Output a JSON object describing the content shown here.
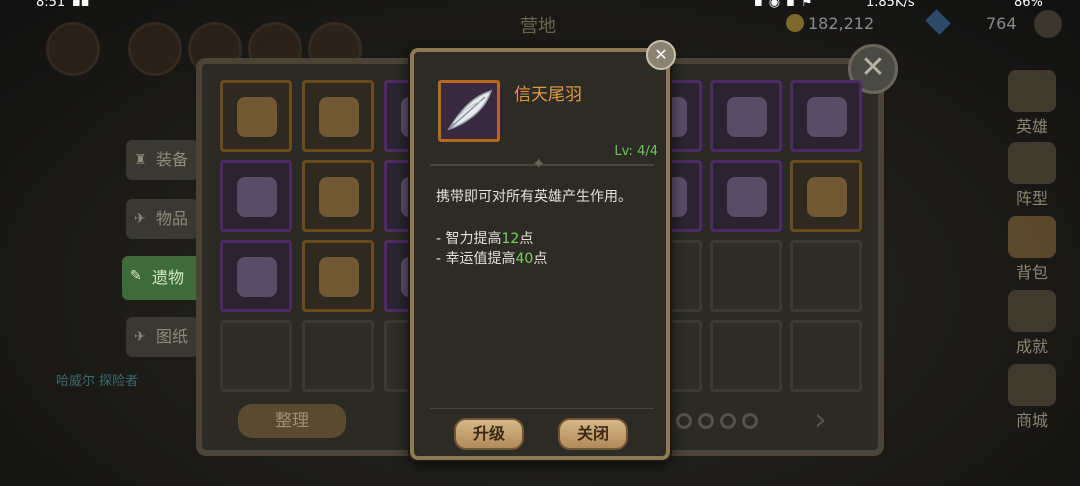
{
  "status_bar": {
    "time": "8:51",
    "left_icons": "▪▪",
    "signal_icons": "▪◉▪⚑",
    "net_speed": "1.85K/s",
    "battery": "86%"
  },
  "header": {
    "title": "营地",
    "gold": "182,212",
    "gems": "764"
  },
  "side_tabs": [
    {
      "label": "装备",
      "icon": "armor-icon"
    },
    {
      "label": "物品",
      "icon": "scroll-icon"
    },
    {
      "label": "遗物",
      "icon": "relic-icon"
    },
    {
      "label": "图纸",
      "icon": "blueprint-icon"
    }
  ],
  "sort_button": "整理",
  "footer_names": "哈威尔  探险者",
  "right_menu": [
    {
      "label": "英雄",
      "icon": "crown-icon"
    },
    {
      "label": "阵型",
      "icon": "target-icon"
    },
    {
      "label": "背包",
      "icon": "backpack-icon"
    },
    {
      "label": "成就",
      "icon": "trophy-icon"
    },
    {
      "label": "商城",
      "icon": "chest-icon"
    }
  ],
  "inventory_items": [
    {
      "name": "potion-bottle",
      "rarity": "orange"
    },
    {
      "name": "wheat-bundle",
      "rarity": "orange"
    },
    {
      "name": "bone-item",
      "rarity": "purple"
    },
    {
      "name": "crystal-shard",
      "rarity": "purple"
    },
    {
      "name": "dark-ore",
      "rarity": "purple"
    },
    {
      "name": "fang-item",
      "rarity": "purple"
    },
    {
      "name": "vial-item",
      "rarity": "purple"
    },
    {
      "name": "fern-leaf",
      "rarity": "orange"
    },
    {
      "name": "stone-item",
      "rarity": "purple"
    },
    {
      "name": "rock-item",
      "rarity": "purple"
    },
    {
      "name": "purple-moss",
      "rarity": "purple"
    },
    {
      "name": "horn-item",
      "rarity": "orange"
    },
    {
      "name": "dagger-item",
      "rarity": "purple"
    },
    {
      "name": "blue-spider",
      "rarity": "orange"
    },
    {
      "name": "flower-item",
      "rarity": "purple"
    }
  ],
  "tooltip": {
    "item_name": "信天尾羽",
    "item_icon": "white-feather-icon",
    "level": "Lv: 4/4",
    "description": "携带即可对所有英雄产生作用。",
    "stats": [
      {
        "prefix": "- 智力提高",
        "value": "12",
        "suffix": "点"
      },
      {
        "prefix": "- 幸运值提高",
        "value": "40",
        "suffix": "点"
      }
    ],
    "upgrade_button": "升级",
    "close_button": "关闭"
  },
  "colors": {
    "orange_rarity": "#b86a1a",
    "purple_rarity": "#6a2a90",
    "stat_green": "#7cd064",
    "name_orange": "#e39a3d"
  }
}
